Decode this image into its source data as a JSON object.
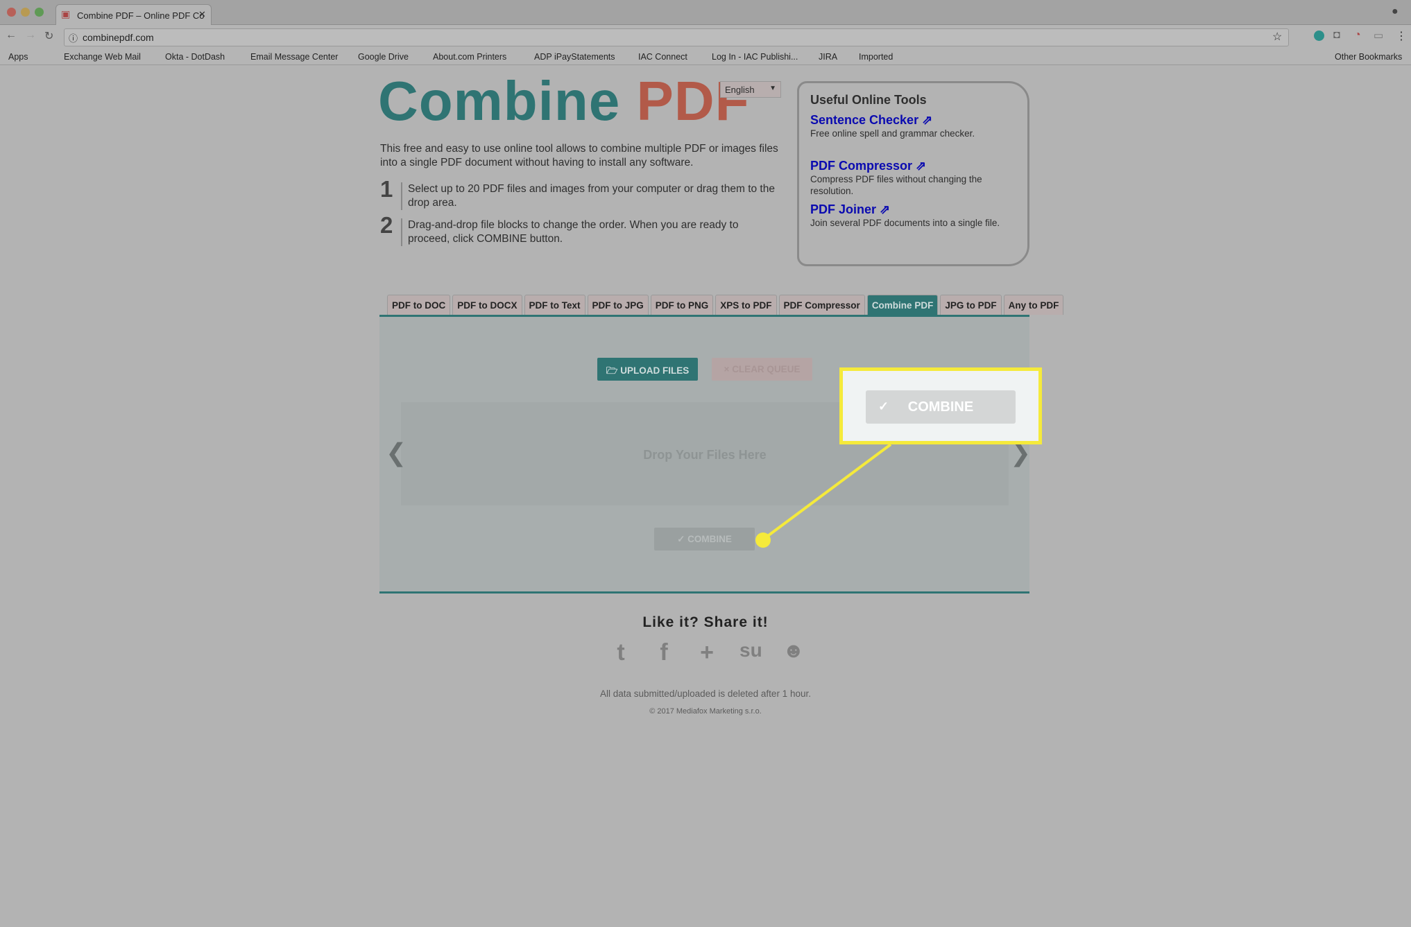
{
  "browser": {
    "tab_title": "Combine PDF – Online PDF Co",
    "url": "combinepdf.com",
    "bookmarks": [
      "Apps",
      "Exchange Web Mail",
      "Okta - DotDash",
      "Email Message Center",
      "Google Drive",
      "About.com Printers",
      "ADP iPayStatements",
      "IAC Connect",
      "Log In - IAC Publishi...",
      "JIRA",
      "Imported"
    ],
    "other_bookmarks": "Other Bookmarks"
  },
  "header": {
    "logo_part1": "Combine",
    "logo_part2": "PDF",
    "language": "English",
    "description": "This free and easy to use online tool allows to combine multiple PDF or images files into a single PDF document without having to install any software.",
    "steps": [
      {
        "num": "1",
        "text": "Select up to 20 PDF files and images from your computer or drag them to the drop area."
      },
      {
        "num": "2",
        "text": "Drag-and-drop file blocks to change the order. When you are ready to proceed, click COMBINE button."
      }
    ]
  },
  "tools": {
    "title": "Useful Online Tools",
    "items": [
      {
        "name": "Sentence Checker",
        "desc": "Free online spell and grammar checker."
      },
      {
        "name": "PDF Compressor",
        "desc": "Compress PDF files without changing the resolution."
      },
      {
        "name": "PDF Joiner",
        "desc": "Join several PDF documents into a single file."
      }
    ]
  },
  "tabs": [
    "PDF to DOC",
    "PDF to DOCX",
    "PDF to Text",
    "PDF to JPG",
    "PDF to PNG",
    "XPS to PDF",
    "PDF Compressor",
    "Combine PDF",
    "JPG to PDF",
    "Any to PDF"
  ],
  "active_tab": "Combine PDF",
  "panel": {
    "upload": "UPLOAD FILES",
    "clear": "CLEAR QUEUE",
    "drop": "Drop Your Files Here",
    "combine": "COMBINE"
  },
  "callout": {
    "combine": "COMBINE",
    "highlight_color": "#f5ea3b"
  },
  "footer": {
    "share": "Like it? Share it!",
    "social": [
      "twitter-icon",
      "facebook-icon",
      "google-plus-icon",
      "stumbleupon-icon",
      "reddit-icon"
    ],
    "note": "All data submitted/uploaded is deleted after 1 hour.",
    "copyright": "© 2017 Mediafox Marketing s.r.o."
  },
  "colors": {
    "brand_teal": "#2f7473",
    "brand_red": "#b25a49",
    "link": "#0a0ab0"
  }
}
